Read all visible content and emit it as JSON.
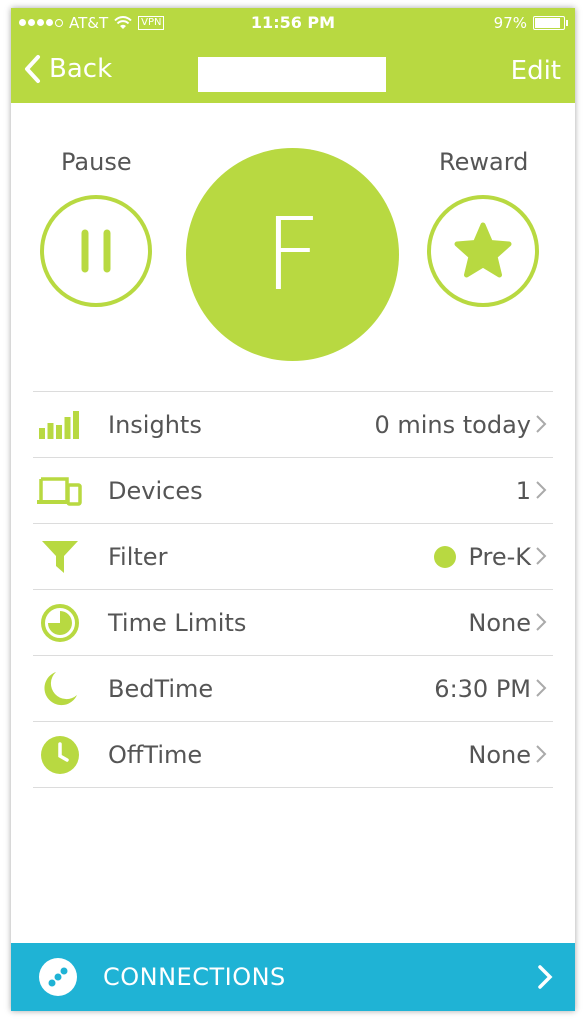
{
  "status_bar": {
    "carrier": "AT&T",
    "vpn": "VPN",
    "time": "11:56 PM",
    "battery": "97%",
    "battery_level": 0.97
  },
  "nav": {
    "back_label": "Back",
    "edit_label": "Edit"
  },
  "controls": {
    "pause_label": "Pause",
    "reward_label": "Reward",
    "profile_initial": "F"
  },
  "settings": {
    "insights": {
      "label": "Insights",
      "value": "0 mins today"
    },
    "devices": {
      "label": "Devices",
      "value": "1"
    },
    "filter": {
      "label": "Filter",
      "value": "Pre-K"
    },
    "time_limits": {
      "label": "Time Limits",
      "value": "None"
    },
    "bedtime": {
      "label": "BedTime",
      "value": "6:30 PM"
    },
    "offtime": {
      "label": "OffTime",
      "value": "None"
    }
  },
  "footer": {
    "connections_label": "CONNECTIONS"
  },
  "colors": {
    "accent": "#b8d941",
    "connections_bar": "#1fb3d5",
    "text": "#555555"
  },
  "icons": [
    "wifi-icon",
    "back-chevron-icon",
    "pause-icon",
    "star-icon",
    "bar-chart-icon",
    "devices-icon",
    "funnel-icon",
    "pie-clock-icon",
    "moon-icon",
    "clock-icon",
    "chevron-right-icon",
    "connections-dots-icon"
  ]
}
